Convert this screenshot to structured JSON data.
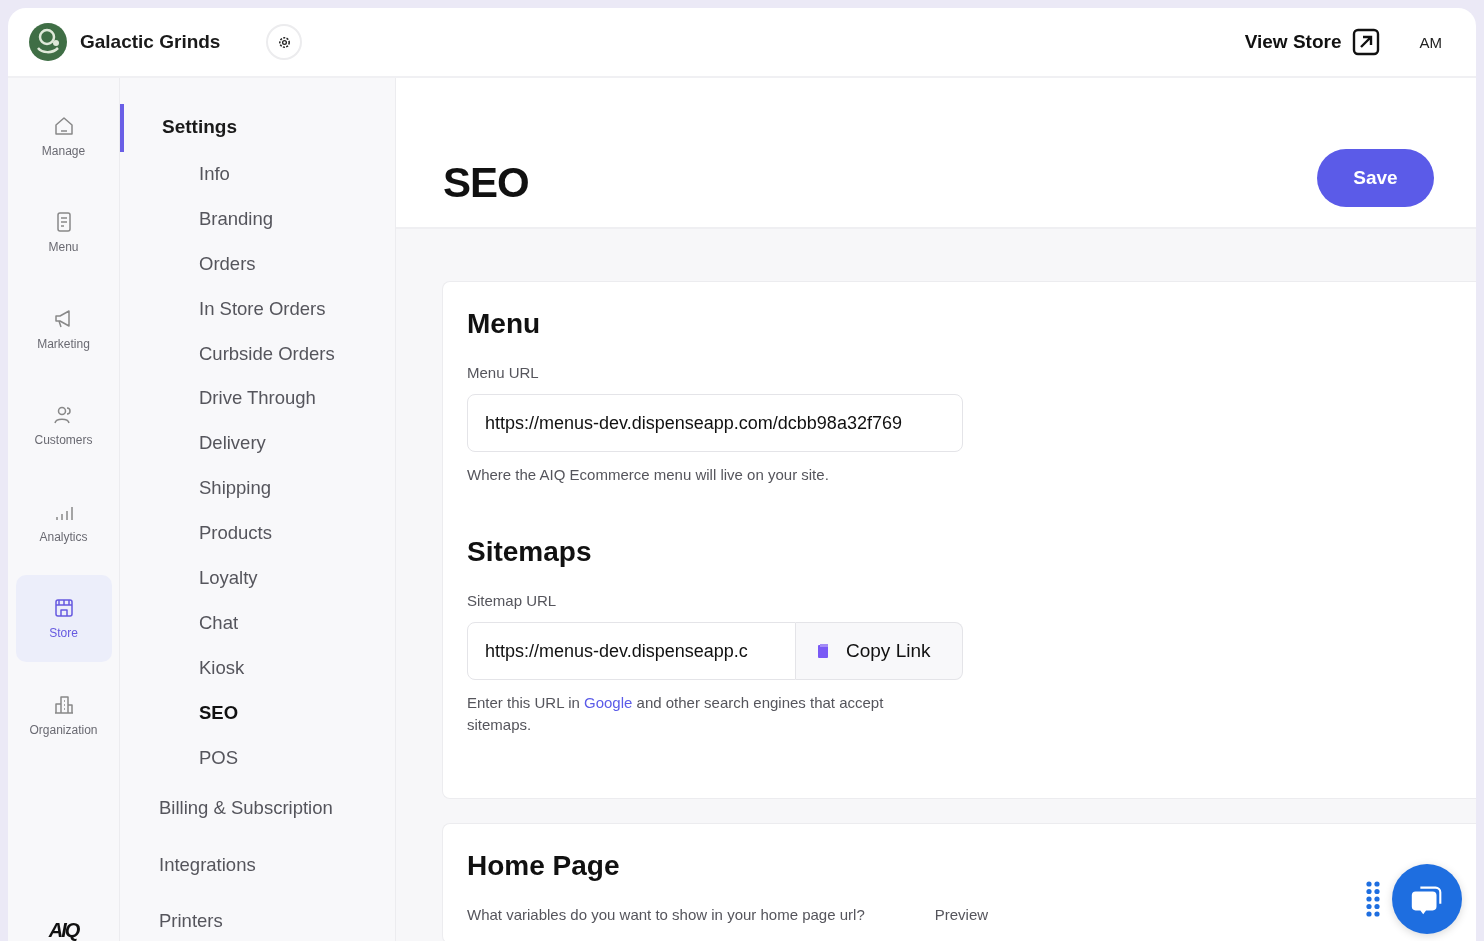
{
  "header": {
    "store_name": "Galactic Grinds",
    "view_store": "View Store",
    "user_initials": "AM"
  },
  "rail": [
    {
      "kind": "home",
      "label": "Manage",
      "selected": false
    },
    {
      "kind": "doc",
      "label": "Menu",
      "selected": false
    },
    {
      "kind": "megaphone",
      "label": "Marketing",
      "selected": false
    },
    {
      "kind": "people",
      "label": "Customers",
      "selected": false
    },
    {
      "kind": "bars",
      "label": "Analytics",
      "selected": false
    },
    {
      "kind": "store",
      "label": "Store",
      "selected": true
    },
    {
      "kind": "building",
      "label": "Organization",
      "selected": false
    }
  ],
  "rail_logo": "AIQ",
  "sidebar": {
    "heading": "Settings",
    "items": [
      {
        "label": "Info",
        "selected": false
      },
      {
        "label": "Branding",
        "selected": false
      },
      {
        "label": "Orders",
        "selected": false
      },
      {
        "label": "In Store Orders",
        "selected": false
      },
      {
        "label": "Curbside Orders",
        "selected": false
      },
      {
        "label": "Drive Through",
        "selected": false
      },
      {
        "label": "Delivery",
        "selected": false
      },
      {
        "label": "Shipping",
        "selected": false
      },
      {
        "label": "Products",
        "selected": false
      },
      {
        "label": "Loyalty",
        "selected": false
      },
      {
        "label": "Chat",
        "selected": false
      },
      {
        "label": "Kiosk",
        "selected": false
      },
      {
        "label": "SEO",
        "selected": true
      },
      {
        "label": "POS",
        "selected": false
      }
    ],
    "sections": [
      {
        "label": "Billing & Subscription"
      },
      {
        "label": "Integrations"
      },
      {
        "label": "Printers"
      }
    ]
  },
  "page": {
    "title": "SEO",
    "save": "Save"
  },
  "menu_card": {
    "heading": "Menu",
    "field_label": "Menu URL",
    "value": "https://menus-dev.dispenseapp.com/dcbb98a32f769",
    "help": "Where the AIQ Ecommerce menu will live on your site.",
    "sitemaps_heading": "Sitemaps",
    "sitemap_label": "Sitemap URL",
    "sitemap_value": "https://menus-dev.dispenseapp.c",
    "copy": "Copy Link",
    "sitemap_help_before": "Enter this URL in",
    "sitemap_link": "Google",
    "sitemap_help_after": "and other search engines that accept sitemaps."
  },
  "home_card": {
    "heading": "Home Page",
    "question": "What variables do you want to show in your home page url?",
    "preview": "Preview"
  }
}
